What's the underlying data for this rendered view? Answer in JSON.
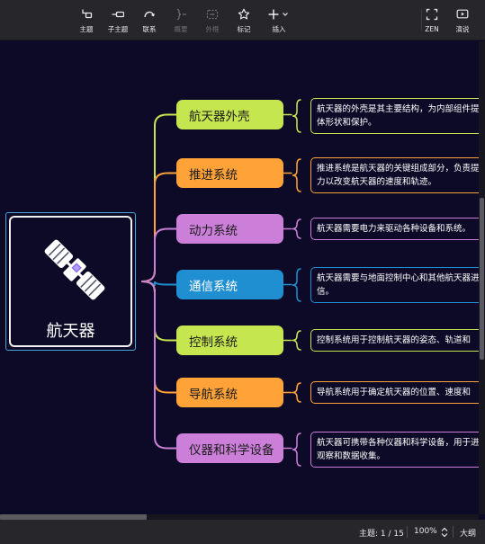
{
  "toolbar": {
    "buttons": [
      {
        "id": "topic",
        "label": "主题",
        "icon": "topic-icon"
      },
      {
        "id": "subtopic",
        "label": "子主题",
        "icon": "subtopic-icon"
      },
      {
        "id": "relationship",
        "label": "联系",
        "icon": "relationship-icon"
      },
      {
        "id": "summary",
        "label": "概要",
        "icon": "summary-icon"
      },
      {
        "id": "boundary",
        "label": "外框",
        "icon": "boundary-icon"
      },
      {
        "id": "marker",
        "label": "标记",
        "icon": "star-icon"
      },
      {
        "id": "insert",
        "label": "插入",
        "icon": "plus-icon"
      },
      {
        "id": "zen",
        "label": "ZEN",
        "icon": "zen-icon"
      },
      {
        "id": "present",
        "label": "演说",
        "icon": "present-icon"
      }
    ]
  },
  "map": {
    "root": {
      "label": "航天器",
      "icon": "satellite-icon"
    },
    "colors": {
      "yellow": "#c6e650",
      "orange": "#ffa238",
      "purple": "#cc7fd9",
      "blue": "#1f8fd2"
    },
    "branches": [
      {
        "label": "航天器外壳",
        "color": "#c6e650",
        "lines": [
          "航天器的外壳是其主要结构，为内部组件提供",
          "体形状和保护。"
        ]
      },
      {
        "label": "推进系统",
        "color": "#ffa238",
        "lines": [
          "推进系统是航天器的关键组成部分，负责提供",
          "力以改变航天器的速度和轨迹。"
        ]
      },
      {
        "label": "动力系统",
        "color": "#cc7fd9",
        "lines": [
          "航天器需要电力来驱动各种设备和系统。"
        ]
      },
      {
        "label": "通信系统",
        "color": "#1f8fd2",
        "lines": [
          "航天器需要与地面控制中心和其他航天器进行",
          "信。"
        ]
      },
      {
        "label": "控制系统",
        "color": "#c6e650",
        "lines": [
          "控制系统用于控制航天器的姿态、轨道和"
        ]
      },
      {
        "label": "导航系统",
        "color": "#ffa238",
        "lines": [
          "导航系统用于确定航天器的位置、速度和"
        ]
      },
      {
        "label": "仪器和科学设备",
        "color": "#cc7fd9",
        "lines": [
          "航天器可携带各种仪器和科学设备，用于进",
          "观察和数据收集。"
        ]
      }
    ]
  },
  "status": {
    "topics": "主题: 1 / 15",
    "zoom": "100%",
    "outline": "大纲"
  }
}
